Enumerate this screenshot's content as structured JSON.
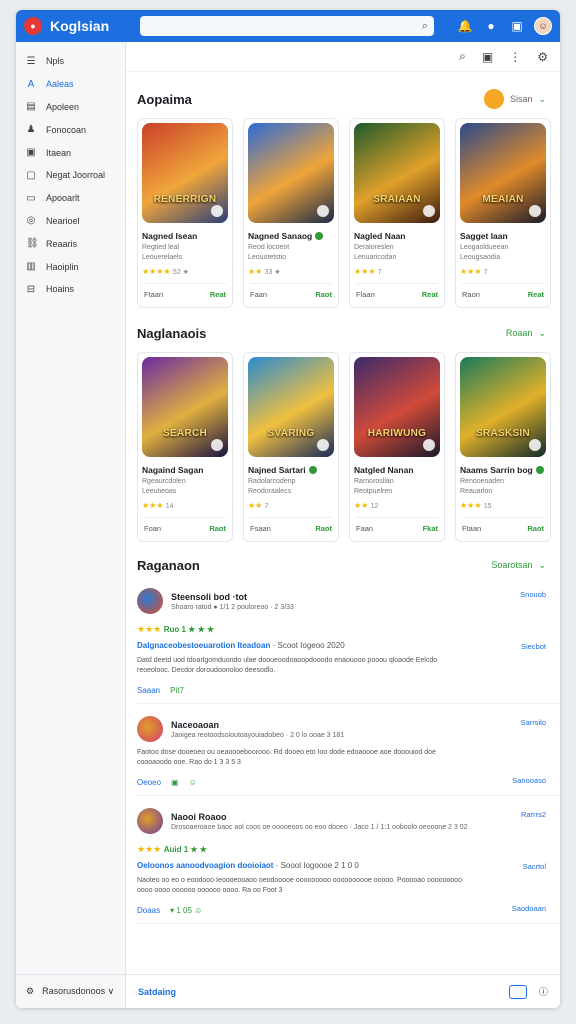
{
  "app": {
    "title": "Koglsian",
    "logo_glyph": "●"
  },
  "topbar": {
    "search_icon": "search-icon",
    "icons": [
      "bell-icon",
      "user-icon",
      "chat-icon"
    ]
  },
  "sidebar": {
    "items": [
      {
        "label": "Npls",
        "icon": "☰",
        "active": false
      },
      {
        "label": "Aaleas",
        "icon": "A",
        "active": true
      },
      {
        "label": "Apoleen",
        "icon": "▤",
        "active": false
      },
      {
        "label": "Fonocoan",
        "icon": "♟",
        "active": false
      },
      {
        "label": "Itaean",
        "icon": "▣",
        "active": false
      },
      {
        "label": "Negat Joorroal",
        "icon": "▢",
        "active": false
      },
      {
        "label": "Apooarlt",
        "icon": "▭",
        "active": false
      },
      {
        "label": "Nearioel",
        "icon": "◎",
        "active": false
      },
      {
        "label": "Reaaris",
        "icon": "⛓",
        "active": false
      },
      {
        "label": "Haoiplin",
        "icon": "▥",
        "active": false
      },
      {
        "label": "Hoains",
        "icon": "⊟",
        "active": false
      }
    ],
    "footer": "Rasorusdonoos ∨"
  },
  "section1": {
    "title": "Aopaima",
    "link": "Sisan",
    "cards": [
      {
        "title": "Nagned Isean",
        "sub1": "Regtied leal",
        "sub2": "Leouerelaels",
        "stars": "★★★★",
        "rating": "52 ★",
        "left": "Ftaan",
        "right": "Reat",
        "art": "RENERRIGN",
        "verified": false,
        "colors": [
          "#c9402a",
          "#f0a63b",
          "#2a3d7a"
        ]
      },
      {
        "title": "Nagned Sanaog",
        "sub1": "Reod locoeot",
        "sub2": "Leouotetstio",
        "stars": "★★",
        "rating": "33 ★",
        "left": "Faan",
        "right": "Raot",
        "art": "",
        "verified": true,
        "colors": [
          "#2b6ad6",
          "#f0a43a",
          "#1a2a4a"
        ]
      },
      {
        "title": "Nagled Naan",
        "sub1": "Deraloreslen",
        "sub2": "Lenuaricodan",
        "stars": "★★★",
        "rating": "7",
        "left": "Flaan",
        "right": "Reat",
        "art": "SRAIAAN",
        "verified": false,
        "colors": [
          "#1f5a2a",
          "#e0a02a",
          "#3a1a10"
        ]
      },
      {
        "title": "Sagget laan",
        "sub1": "Leogaoldueean",
        "sub2": "Leougsaodia",
        "stars": "★★★",
        "rating": "7",
        "left": "Raon",
        "right": "Reat",
        "art": "MEAIAN",
        "verified": false,
        "colors": [
          "#2a4a8a",
          "#e08a2a",
          "#1a1a2a"
        ]
      }
    ]
  },
  "section2": {
    "title": "Naglanaois",
    "link": "Roaan",
    "cards": [
      {
        "title": "Nagaind Sagan",
        "sub1": "Rgeaurcdolen",
        "sub2": "Leeutieoas",
        "stars": "★★★",
        "rating": "14",
        "left": "Foan",
        "right": "Raot",
        "art": "SEARCH",
        "verified": false,
        "colors": [
          "#6a2aa0",
          "#e0b040",
          "#1a1040"
        ]
      },
      {
        "title": "Najned Sartari",
        "sub1": "Radolarcodenp",
        "sub2": "Reodoraalecs",
        "stars": "★★",
        "rating": "7",
        "left": "Fsaan",
        "right": "Raot",
        "art": "SVARING",
        "verified": true,
        "colors": [
          "#2a8ad0",
          "#f0c040",
          "#1a2a5a"
        ]
      },
      {
        "title": "Natgled Nanan",
        "sub1": "Rarnorosllan",
        "sub2": "Reotpuelren",
        "stars": "★★",
        "rating": "12",
        "left": "Faan",
        "right": "Fkat",
        "art": "HARIWUNG",
        "verified": false,
        "colors": [
          "#3a2a6a",
          "#d04a3a",
          "#1a1a2a"
        ]
      },
      {
        "title": "Naams Sarrin bog",
        "sub1": "Renooeoaden",
        "sub2": "Reauarlon",
        "stars": "★★★",
        "rating": "15",
        "left": "Ftaan",
        "right": "Raot",
        "art": "SRASKSIN",
        "verified": true,
        "colors": [
          "#1a7a5a",
          "#e0b02a",
          "#102a2a"
        ]
      }
    ]
  },
  "section3": {
    "title": "Raganaon",
    "link": "Soarotsan",
    "reviews": [
      {
        "name": "Steensoli bod ·tot",
        "meta": "Shoaro ratod ● 1/1 2 pouloreoo · 2 3/33",
        "link": "Snouob",
        "stars": "★★★",
        "score": "Ruo 1 ★ ★ ★",
        "head": "Dalgnaceobestoeuarotion Iteadoan",
        "headsub": "· Scoot Iogeoo 2020",
        "head_link": "Siecbot",
        "body": "Datd deetd uod tdoarlgomduondo ulae dooueoodoaoopdooodo enaouooo pooou qloaode Eelcdo reoeolooc. Decdor doroudoonoloo deesodlo.",
        "acts": [
          "Saaan",
          "Pit7"
        ],
        "avcolors": [
          "#e04a2a",
          "#2a7ad0"
        ]
      },
      {
        "name": "Naceoaoan",
        "meta": "Jaoigea reotoodsoioutoayouiadobeo · 2 0 lo ooae 3 181",
        "link": "Sarrsilo",
        "stars": "",
        "score": "",
        "head": "",
        "headsub": "",
        "head_link": "",
        "body": "Faotoo dose dooeoeo ou oeaoooeboorooo. Rd dooeo eto Ioo dode edoaoooe aoe dooouiod doe coooaoodo ooe. Rao do 1 3 3 5 3",
        "acts": [
          "Oeoeo",
          "▣",
          "☺"
        ],
        "actlink": "Sanooaso",
        "avcolors": [
          "#d03a6a",
          "#e0a02a"
        ]
      },
      {
        "name": "Naooi Roaoo",
        "meta": "Drosoaeroaoe baoc aol coos oe ooooeoos oo eoo dooeo · Jaco 1 / 1:1 ooboolo oeooone 2 3 02",
        "link": "Rarrrs2",
        "stars": "★★★",
        "score": "Auid 1 ★ ★",
        "head": "Oeloonos aanoodvoagion dooioiaot",
        "headsub": "· Soool Iogoooe 2 1 0 0",
        "head_link": "Sacrtol",
        "body": "Naoteo oo eo o eoodooo Ieoooeooaoo oeodooooe ooooooooo oooooooooe ooooo. Pooooao ooooooooo oooo oooo oooooo oooooo oooo. Ra oo Foot 3",
        "acts": [
          "Doaas",
          "▾ 1 05 ☺"
        ],
        "actlink": "Saodoaan",
        "avcolors": [
          "#6a3aa0",
          "#e0a02a"
        ]
      }
    ]
  },
  "bottombar": {
    "left": "Satdaing"
  }
}
